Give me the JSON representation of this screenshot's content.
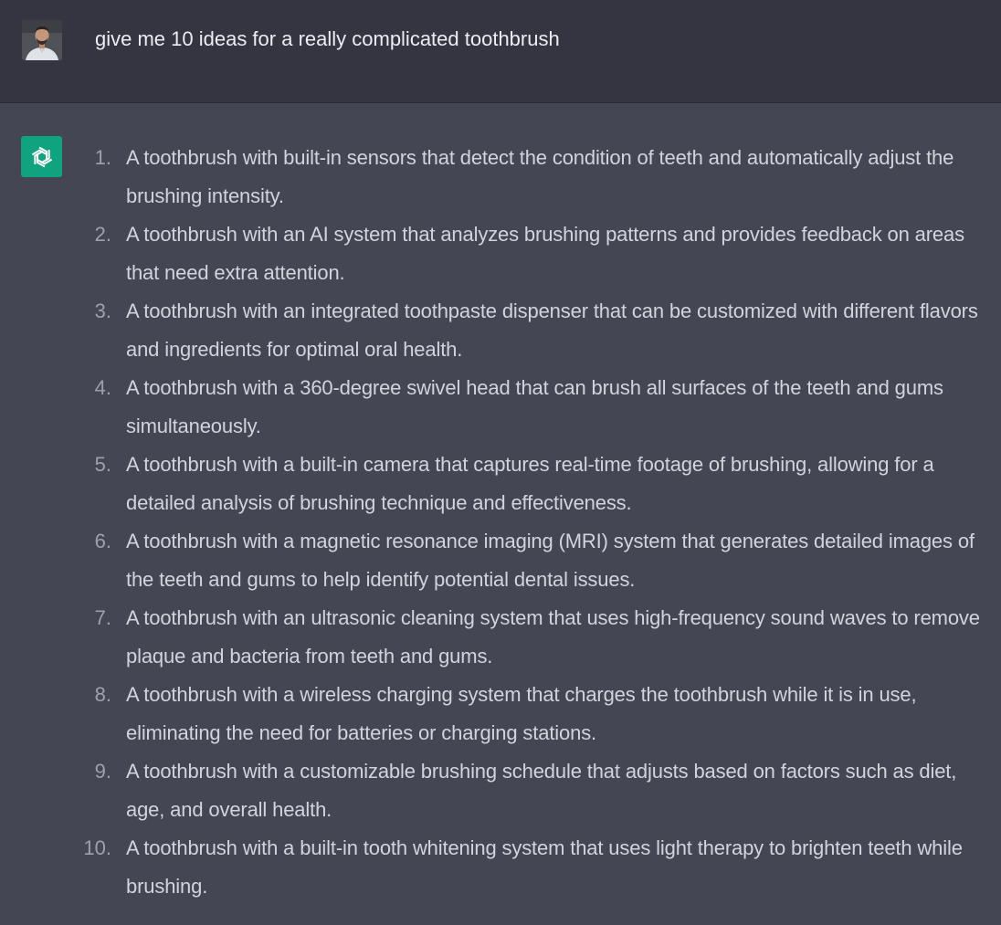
{
  "user_message": {
    "text": "give me 10 ideas for a really complicated toothbrush",
    "avatar_icon": "user-photo-avatar"
  },
  "assistant_message": {
    "avatar_icon": "openai-logo-icon",
    "avatar_color": "#10a37f",
    "items": [
      {
        "number": "1.",
        "text": "A toothbrush with built-in sensors that detect the condition of teeth and automatically adjust the brushing intensity."
      },
      {
        "number": "2.",
        "text": "A toothbrush with an AI system that analyzes brushing patterns and provides feedback on areas that need extra attention."
      },
      {
        "number": "3.",
        "text": "A toothbrush with an integrated toothpaste dispenser that can be customized with different flavors and ingredients for optimal oral health."
      },
      {
        "number": "4.",
        "text": "A toothbrush with a 360-degree swivel head that can brush all surfaces of the teeth and gums simultaneously."
      },
      {
        "number": "5.",
        "text": "A toothbrush with a built-in camera that captures real-time footage of brushing, allowing for a detailed analysis of brushing technique and effectiveness."
      },
      {
        "number": "6.",
        "text": "A toothbrush with a magnetic resonance imaging (MRI) system that generates detailed images of the teeth and gums to help identify potential dental issues."
      },
      {
        "number": "7.",
        "text": "A toothbrush with an ultrasonic cleaning system that uses high-frequency sound waves to remove plaque and bacteria from teeth and gums."
      },
      {
        "number": "8.",
        "text": "A toothbrush with a wireless charging system that charges the toothbrush while it is in use, eliminating the need for batteries or charging stations."
      },
      {
        "number": "9.",
        "text": "A toothbrush with a customizable brushing schedule that adjusts based on factors such as diet, age, and overall health."
      },
      {
        "number": "10.",
        "text": "A toothbrush with a built-in tooth whitening system that uses light therapy to brighten teeth while brushing."
      }
    ]
  }
}
